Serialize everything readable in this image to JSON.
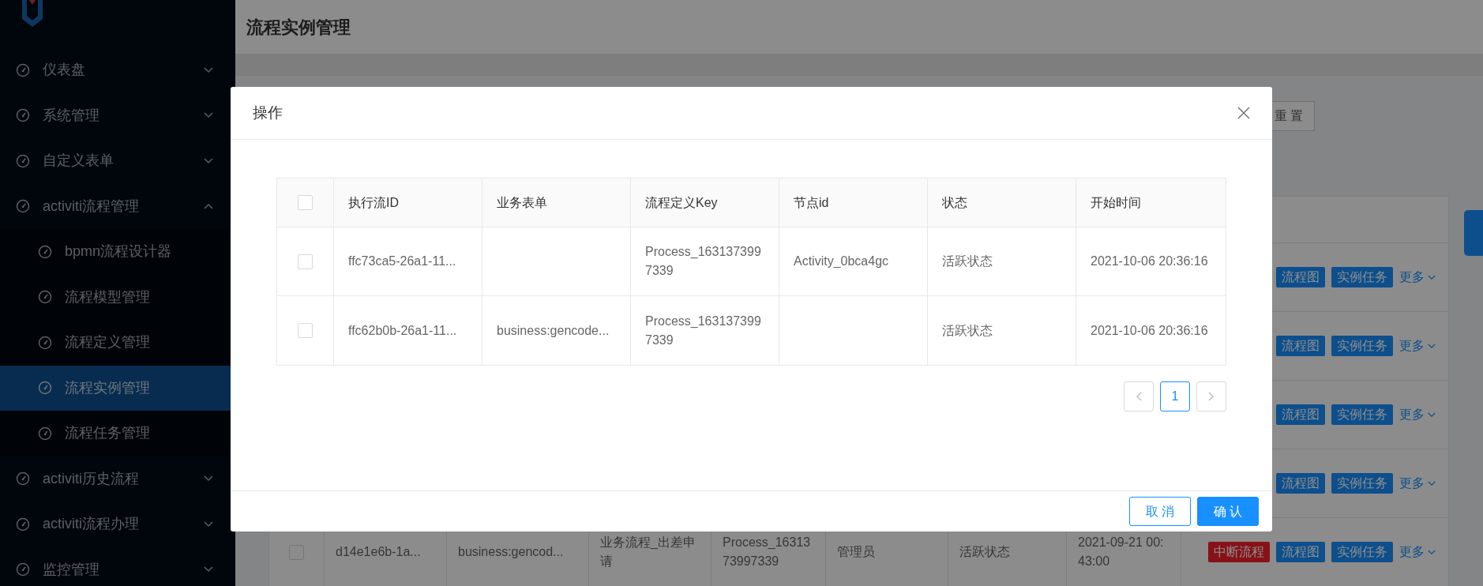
{
  "sidebar": {
    "items": [
      {
        "label": "仪表盘",
        "expanded": false,
        "selected": false
      },
      {
        "label": "系统管理",
        "expanded": false,
        "selected": false
      },
      {
        "label": "自定义表单",
        "expanded": false,
        "selected": false
      },
      {
        "label": "activiti流程管理",
        "expanded": true,
        "selected": false,
        "children": [
          {
            "label": "bpmn流程设计器",
            "selected": false
          },
          {
            "label": "流程模型管理",
            "selected": false
          },
          {
            "label": "流程定义管理",
            "selected": false
          },
          {
            "label": "流程实例管理",
            "selected": true
          },
          {
            "label": "流程任务管理",
            "selected": false
          }
        ]
      },
      {
        "label": "activiti历史流程",
        "expanded": false,
        "selected": false
      },
      {
        "label": "activiti流程办理",
        "expanded": false,
        "selected": false
      },
      {
        "label": "监控管理",
        "expanded": false,
        "selected": false
      }
    ]
  },
  "page": {
    "title": "流程实例管理",
    "reset_button": "重 置",
    "rows": [
      {
        "actions": [
          {
            "kind": "primary",
            "label": "流程图"
          },
          {
            "kind": "primary",
            "label": "实例任务"
          },
          {
            "kind": "more",
            "label": "更多"
          }
        ]
      },
      {
        "actions": [
          {
            "kind": "primary",
            "label": "流程图"
          },
          {
            "kind": "primary",
            "label": "实例任务"
          },
          {
            "kind": "more",
            "label": "更多"
          }
        ]
      },
      {
        "actions": [
          {
            "kind": "primary",
            "label": "流程图"
          },
          {
            "kind": "primary",
            "label": "实例任务"
          },
          {
            "kind": "more",
            "label": "更多"
          }
        ]
      },
      {
        "actions": [
          {
            "kind": "primary",
            "label": "流程图"
          },
          {
            "kind": "primary",
            "label": "实例任务"
          },
          {
            "kind": "more",
            "label": "更多"
          }
        ]
      },
      {
        "checked": false,
        "cells": [
          "d14e1e6b-1a...",
          "business:gencod...",
          "业务流程_出差申请",
          "Process_1631373997339",
          "管理员",
          "活跃状态",
          "2021-09-21 00:43:00"
        ],
        "actions": [
          {
            "kind": "danger",
            "label": "中断流程"
          },
          {
            "kind": "primary",
            "label": "流程图"
          },
          {
            "kind": "primary",
            "label": "实例任务"
          },
          {
            "kind": "more",
            "label": "更多"
          }
        ]
      }
    ]
  },
  "modal": {
    "title": "操作",
    "columns": [
      "执行流ID",
      "业务表单",
      "流程定义Key",
      "节点id",
      "状态",
      "开始时间"
    ],
    "header_checked": false,
    "rows": [
      {
        "checked": false,
        "cells": [
          "ffc73ca5-26a1-11...",
          "",
          "Process_1631373997339",
          "Activity_0bca4gc",
          "活跃状态",
          "2021-10-06 20:36:16"
        ]
      },
      {
        "checked": false,
        "cells": [
          "ffc62b0b-26a1-11...",
          "business:gencode...",
          "Process_1631373997339",
          "",
          "活跃状态",
          "2021-10-06 20:36:16"
        ]
      }
    ],
    "pages": [
      {
        "label": "1",
        "selected": true
      }
    ],
    "cancel_button": "取 消",
    "confirm_button": "确 认"
  }
}
